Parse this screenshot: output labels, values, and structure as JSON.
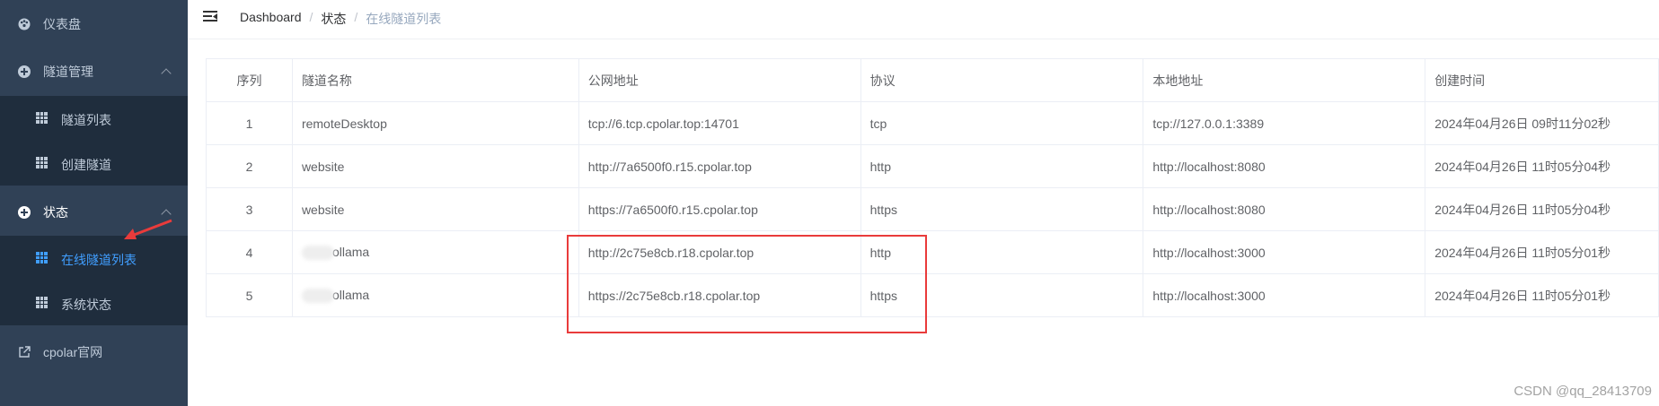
{
  "sidebar": {
    "items": [
      {
        "label": "仪表盘"
      },
      {
        "label": "隧道管理"
      },
      {
        "label": "隧道列表"
      },
      {
        "label": "创建隧道"
      },
      {
        "label": "状态"
      },
      {
        "label": "在线隧道列表"
      },
      {
        "label": "系统状态"
      },
      {
        "label": "cpolar官网"
      }
    ]
  },
  "breadcrumb": [
    "Dashboard",
    "状态",
    "在线隧道列表"
  ],
  "table": {
    "headers": [
      "序列",
      "隧道名称",
      "公网地址",
      "协议",
      "本地地址",
      "创建时间"
    ],
    "rows": [
      [
        "1",
        "remoteDesktop",
        "tcp://6.tcp.cpolar.top:14701",
        "tcp",
        "tcp://127.0.0.1:3389",
        "2024年04月26日 09时11分02秒"
      ],
      [
        "2",
        "website",
        "http://7a6500f0.r15.cpolar.top",
        "http",
        "http://localhost:8080",
        "2024年04月26日 11时05分04秒"
      ],
      [
        "3",
        "website",
        "https://7a6500f0.r15.cpolar.top",
        "https",
        "http://localhost:8080",
        "2024年04月26日 11时05分04秒"
      ],
      [
        "4",
        "ollama",
        "http://2c75e8cb.r18.cpolar.top",
        "http",
        "http://localhost:3000",
        "2024年04月26日 11时05分01秒"
      ],
      [
        "5",
        "ollama",
        "https://2c75e8cb.r18.cpolar.top",
        "https",
        "http://localhost:3000",
        "2024年04月26日 11时05分01秒"
      ]
    ]
  },
  "watermark": "CSDN @qq_28413709",
  "colors": {
    "sidebar_bg": "#304156",
    "submenu_bg": "#1f2d3d",
    "active": "#409eff",
    "highlight": "#e93b3b"
  }
}
